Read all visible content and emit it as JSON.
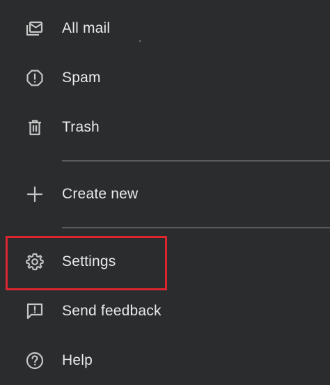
{
  "menu": {
    "items": [
      {
        "id": "all-mail",
        "label": "All mail",
        "icon": "all-mail-icon"
      },
      {
        "id": "spam",
        "label": "Spam",
        "icon": "spam-icon"
      },
      {
        "id": "trash",
        "label": "Trash",
        "icon": "trash-icon"
      },
      {
        "id": "create-new",
        "label": "Create new",
        "icon": "plus-icon"
      },
      {
        "id": "settings",
        "label": "Settings",
        "icon": "gear-icon"
      },
      {
        "id": "send-feedback",
        "label": "Send feedback",
        "icon": "feedback-icon"
      },
      {
        "id": "help",
        "label": "Help",
        "icon": "help-icon"
      }
    ]
  },
  "colors": {
    "background": "#2b2c2e",
    "text": "#e8eaed",
    "icon": "#c4c7c5",
    "divider": "#5a5b5e",
    "highlight_border": "#d9262f"
  }
}
